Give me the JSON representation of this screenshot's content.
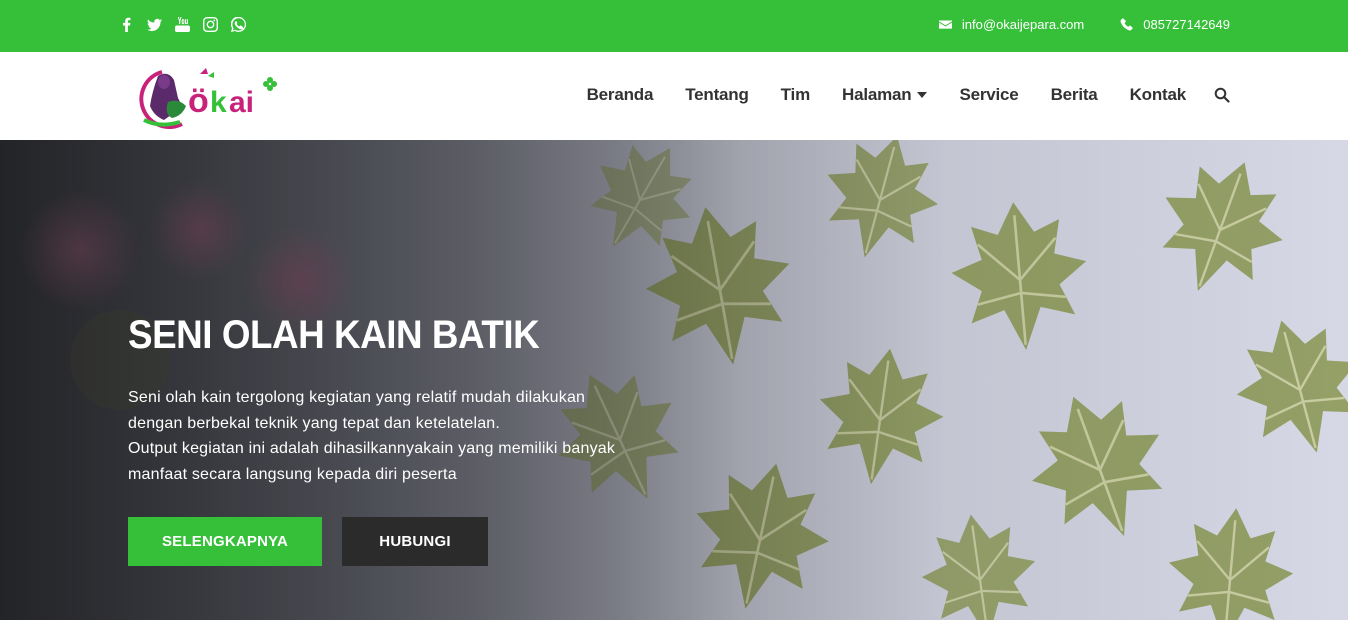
{
  "topbar": {
    "social": [
      "facebook-icon",
      "twitter-icon",
      "youtube-icon",
      "instagram-icon",
      "whatsapp-icon"
    ],
    "email": "info@okaijepara.com",
    "phone": "085727142649",
    "color": "#36c03a"
  },
  "header": {
    "logo_text": "okai",
    "nav": [
      {
        "label": "Beranda"
      },
      {
        "label": "Tentang"
      },
      {
        "label": "Tim"
      },
      {
        "label": "Halaman"
      },
      {
        "label": "Service"
      },
      {
        "label": "Berita"
      },
      {
        "label": "Kontak"
      }
    ]
  },
  "hero": {
    "title": "SENI OLAH KAIN BATIK",
    "line1": "Seni olah kain tergolong kegiatan yang relatif mudah dilakukan",
    "line2": "dengan berbekal teknik yang tepat dan ketelatelan.",
    "line3": "Output kegiatan ini adalah dihasilkannyakain yang memiliki banyak",
    "line4": "manfaat secara langsung kepada diri peserta",
    "primary_button": "SELENGKAPNYA",
    "secondary_button": "HUBUNGI"
  }
}
